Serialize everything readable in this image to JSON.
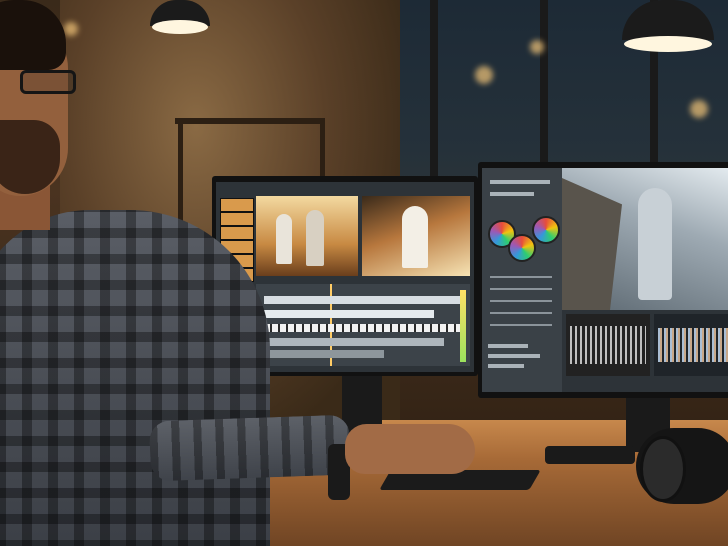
{
  "scene": {
    "description_free": true,
    "colors": {
      "ambient": "#4a3320",
      "desk": "#b07140",
      "screen_ui": "#2d3338",
      "footage_warm": "#d9a25a",
      "footage_cool": "#9aa6b0"
    },
    "icons": [
      "monitor-left",
      "monitor-right",
      "keyboard",
      "mouse",
      "camera"
    ]
  }
}
